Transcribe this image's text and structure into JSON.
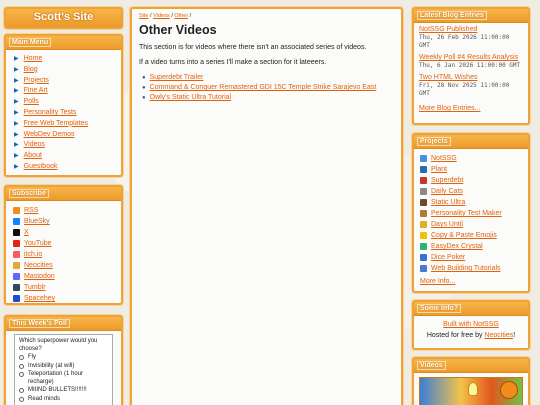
{
  "site": {
    "title": "Scott's Site"
  },
  "main_menu": {
    "title": "Main Menu",
    "items": [
      "Home",
      "Blog",
      "Projects",
      "Fine Art",
      "Polls",
      "Personality Tests",
      "Free Web Templates",
      "WebDev Demos",
      "Videos",
      "About",
      "Guestbook"
    ]
  },
  "subscribe": {
    "title": "Subscribe",
    "items": [
      {
        "label": "RSS",
        "icon": "rss-icon",
        "color": "#f28c1e"
      },
      {
        "label": "BlueSky",
        "icon": "bluesky-icon",
        "color": "#1185fe"
      },
      {
        "label": "X",
        "icon": "x-icon",
        "color": "#111111"
      },
      {
        "label": "YouTube",
        "icon": "youtube-icon",
        "color": "#e62117"
      },
      {
        "label": "itch.io",
        "icon": "itchio-icon",
        "color": "#fa5c5c"
      },
      {
        "label": "Neocities",
        "icon": "neocities-icon",
        "color": "#e9a53c"
      },
      {
        "label": "Mastodon",
        "icon": "mastodon-icon",
        "color": "#6364ff"
      },
      {
        "label": "Tumblr",
        "icon": "tumblr-icon",
        "color": "#36465d"
      },
      {
        "label": "Spacehey",
        "icon": "spacehey-icon",
        "color": "#1d4ed8"
      }
    ]
  },
  "poll": {
    "title": "This Week's Poll",
    "question": "Which superpower would you choose?",
    "options": [
      "Fly",
      "Invisibility (at will)",
      "Teleportation (1 hour recharge)",
      "MIIIND BULLETS!!!!!!!",
      "Read minds"
    ]
  },
  "content": {
    "breadcrumb": [
      "Site",
      "Videos",
      "Other"
    ],
    "title": "Other Videos",
    "intro": "This section is for videos where there isn't an associated series of videos.",
    "note": "If a video turns into a series I'll make a section for it lateeers.",
    "videos": [
      "Superdebt Trailer",
      "Command & Conquer Remastered GDI 15C Temple Strike Sarajevo East",
      "Owly's Static Ultra Tutorial"
    ]
  },
  "blog": {
    "title": "Latest Blog Entries",
    "entries": [
      {
        "title": "NotSSG Published",
        "date": "Thu, 26 Feb 2026 11:00:00 GMT"
      },
      {
        "title": "Weekly Poll #4 Results Analysis",
        "date": "Thu, 6 Jan 2026 11:00:00 GMT"
      },
      {
        "title": "Two HTML Wishes",
        "date": "Fri, 28 Nov 2025 11:00:00 GMT"
      }
    ],
    "more": "More Blog Entries..."
  },
  "projects": {
    "title": "Projects",
    "items": [
      {
        "label": "NotSSG",
        "icon": "notssg-icon",
        "color": "#4a90e2"
      },
      {
        "label": "Plant",
        "icon": "plant-icon",
        "color": "#2b6cb0"
      },
      {
        "label": "Superdebt",
        "icon": "superdebt-icon",
        "color": "#c0392b"
      },
      {
        "label": "Daily Cats",
        "icon": "cat-icon",
        "color": "#8a8a8a"
      },
      {
        "label": "Static Ultra",
        "icon": "static-ultra-icon",
        "color": "#6b4a2b"
      },
      {
        "label": "Personality Test Maker",
        "icon": "person-icon",
        "color": "#b07b3a"
      },
      {
        "label": "Days Until",
        "icon": "clock-icon",
        "color": "#e0b020"
      },
      {
        "label": "Copy & Paste Emojis",
        "icon": "emoji-icon",
        "color": "#f2c200"
      },
      {
        "label": "EasyDex Crystal",
        "icon": "crystal-icon",
        "color": "#2bb673"
      },
      {
        "label": "Dice Poker",
        "icon": "dice-icon",
        "color": "#3a6fd8"
      },
      {
        "label": "Web Building Tutorials",
        "icon": "tutorial-icon",
        "color": "#4a7bd0"
      }
    ],
    "more": "More Info..."
  },
  "some_info": {
    "title": "Some Info?",
    "built": "Built with NotSSG",
    "hosted_prefix": "Hosted for free by ",
    "hosted_link": "Neocities",
    "hosted_suffix": "!"
  },
  "videos_panel": {
    "title": "Videos"
  }
}
